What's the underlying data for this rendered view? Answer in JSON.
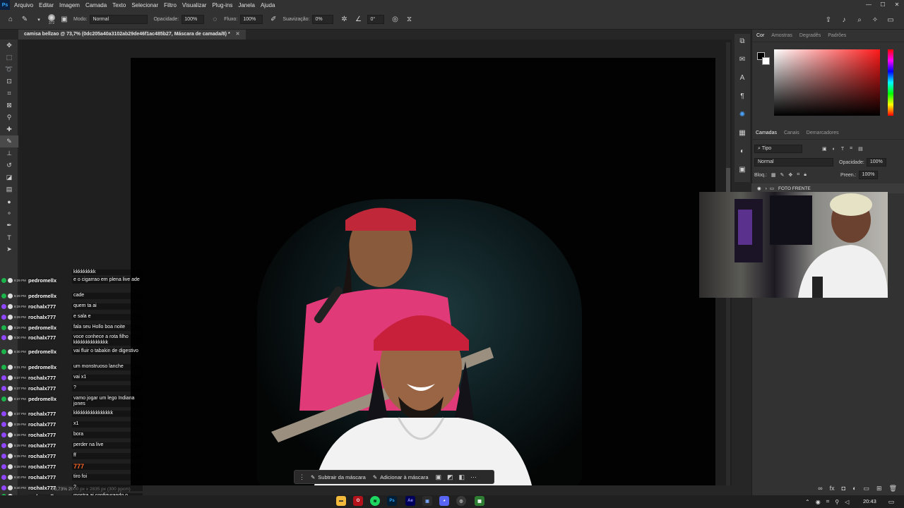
{
  "menu": {
    "logo": "Ps",
    "items": [
      "Arquivo",
      "Editar",
      "Imagem",
      "Camada",
      "Texto",
      "Selecionar",
      "Filtro",
      "Visualizar",
      "Plug-ins",
      "Janela",
      "Ajuda"
    ]
  },
  "options": {
    "brush_size": "372",
    "mode_label": "Modo:",
    "mode_value": "Normal",
    "opacity_label": "Opacidade:",
    "opacity_value": "100%",
    "flow_label": "Fluxo:",
    "flow_value": "100%",
    "smoothing_label": "Suavização:",
    "smoothing_value": "0%",
    "angle_value": "0°"
  },
  "document": {
    "tab_title": "camisa bellzao @ 73,7% (0dc205a40a3102ab29de46f1ac485b27, Máscara de camada/8) *",
    "status": "73,73%   2000 px x 2835 px (300 ppcm)"
  },
  "mask_bar": {
    "subtract": "Subtrair da máscara",
    "add": "Adicionar à máscara"
  },
  "color_panel": {
    "tabs": [
      "Cor",
      "Amostras",
      "Degradês",
      "Padrões"
    ],
    "foreground": "#000000",
    "background": "#ffffff",
    "hue": "#ff1a1a"
  },
  "layers_panel": {
    "tabs": [
      "Camadas",
      "Canais",
      "Demarcadores"
    ],
    "filter": "Tipo",
    "blend": "Normal",
    "opacity_label": "Opacidade:",
    "opacity_value": "100%",
    "lock_label": "Bloq.:",
    "fill_label": "Preen.:",
    "fill_value": "100%",
    "layer_name": "FOTO FRENTE"
  },
  "chat": [
    {
      "time": "",
      "user": "",
      "msg": "kkkkkkkkk"
    },
    {
      "time": "8:29 PM",
      "user": "pedromellx",
      "msg": "e o cigarrao em plena live ade"
    },
    {
      "time": "8:29 PM",
      "user": "pedromellx",
      "msg": "cade"
    },
    {
      "time": "8:29 PM",
      "user": "rochalx777",
      "msg": "quem ta ai"
    },
    {
      "time": "8:29 PM",
      "user": "rochalx777",
      "msg": "e sala e"
    },
    {
      "time": "8:29 PM",
      "user": "pedromellx",
      "msg": "fala seu Hollo boa noite"
    },
    {
      "time": "8:30 PM",
      "user": "rochalx777",
      "msg": "voce conhece a rota filho kkkkkkkkkkkkkk"
    },
    {
      "time": "8:30 PM",
      "user": "pedromellx",
      "msg": "vai fluir o tabakin de digestivo"
    },
    {
      "time": "8:31 PM",
      "user": "pedromellx",
      "msg": "um monstruoso lanche"
    },
    {
      "time": "8:37 PM",
      "user": "rochalx777",
      "msg": "vai x1"
    },
    {
      "time": "8:37 PM",
      "user": "rochalx777",
      "msg": "?"
    },
    {
      "time": "8:37 PM",
      "user": "pedromellx",
      "msg": "vamo jogar um lego Indiana jones"
    },
    {
      "time": "8:37 PM",
      "user": "rochalx777",
      "msg": "kkkkkkkkkkkkkkkk"
    },
    {
      "time": "8:39 PM",
      "user": "rochalx777",
      "msg": "x1"
    },
    {
      "time": "8:39 PM",
      "user": "rochalx777",
      "msg": "bora"
    },
    {
      "time": "8:39 PM",
      "user": "rochalx777",
      "msg": "perder na live"
    },
    {
      "time": "8:39 PM",
      "user": "rochalx777",
      "msg": "ff"
    },
    {
      "time": "8:39 PM",
      "user": "rochalx777",
      "msg": "777"
    },
    {
      "time": "8:40 PM",
      "user": "rochalx777",
      "msg": "tiro foi"
    },
    {
      "time": "8:40 PM",
      "user": "rochalx777",
      "msg": "?"
    },
    {
      "time": "8:40 PM",
      "user": "pedromellx",
      "msg": "mostra ai configurando o emuletion na live"
    }
  ],
  "taskbar": {
    "time": "20:43"
  }
}
